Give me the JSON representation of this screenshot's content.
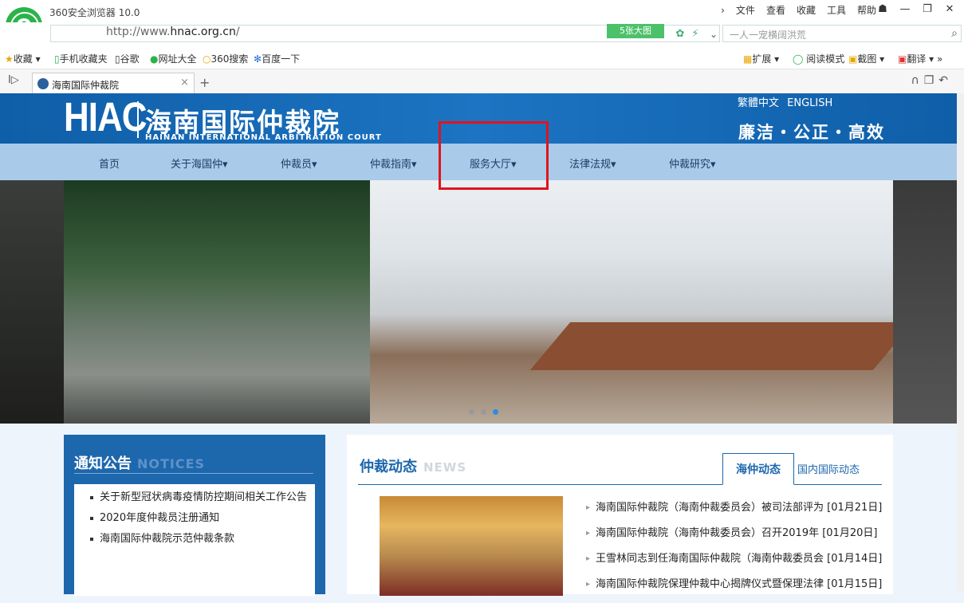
{
  "browser": {
    "app_title": "360安全浏览器 10.0",
    "menu": [
      "文件",
      "查看",
      "收藏",
      "工具",
      "帮助"
    ],
    "url_prefix": "http://www.",
    "url_domain": "hnac.org.cn",
    "url_suffix": "/",
    "image_badge": "5张大图",
    "search_placeholder": "一人一宠横阔洪荒",
    "bookmarks": [
      "收藏",
      "手机收藏夹",
      "谷歌",
      "网址大全",
      "360搜索",
      "百度一下"
    ],
    "toolbar_right": [
      "扩展",
      "阅读模式",
      "截图",
      "翻译"
    ],
    "tab_title": "海南国际仲裁院"
  },
  "site": {
    "logo_text": "HIAC",
    "name_cn": "海南国际仲裁院",
    "name_en": "HAINAN INTERNATIONAL ARBITRATION COURT",
    "lang_links": [
      "繁體中文",
      "ENGLISH"
    ],
    "slogan": "廉洁・公正・高效",
    "nav": [
      "首页",
      "关于海国仲▾",
      "仲裁员▾",
      "仲裁指南▾",
      "服务大厅▾",
      "法律法规▾",
      "仲裁研究▾"
    ]
  },
  "notices": {
    "title": "通知公告",
    "title_en": "NOTICES",
    "items": [
      "关于新型冠状病毒疫情防控期间相关工作公告",
      "2020年度仲裁员注册通知",
      "海南国际仲裁院示范仲裁条款"
    ]
  },
  "news": {
    "title": "仲裁动态",
    "title_en": "NEWS",
    "tabs": [
      "海仲动态",
      "国内国际动态"
    ],
    "items": [
      "海南国际仲裁院（海南仲裁委员会）被司法部评为 [01月21日]",
      "海南国际仲裁院（海南仲裁委员会）召开2019年   [01月20日]",
      "王雪林同志到任海南国际仲裁院（海南仲裁委员会 [01月14日]",
      "海南国际仲裁院保理仲裁中心揭牌仪式暨保理法律 [01月15日]"
    ]
  }
}
